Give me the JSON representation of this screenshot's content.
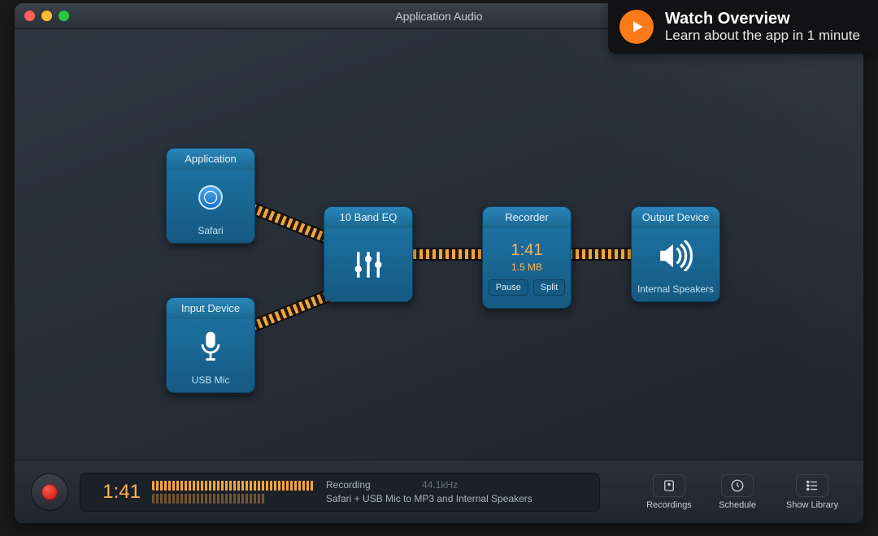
{
  "window": {
    "title": "Application Audio"
  },
  "overview": {
    "title": "Watch Overview",
    "subtitle": "Learn about the app in 1 minute"
  },
  "tiles": {
    "application": {
      "header": "Application",
      "label": "Safari"
    },
    "input": {
      "header": "Input Device",
      "label": "USB Mic"
    },
    "eq": {
      "header": "10 Band EQ"
    },
    "recorder": {
      "header": "Recorder",
      "time": "1:41",
      "size": "1.5 MB",
      "pause_label": "Pause",
      "split_label": "Split"
    },
    "output": {
      "header": "Output Device",
      "label": "Internal Speakers"
    }
  },
  "bottombar": {
    "time": "1:41",
    "status_line1": "Recording",
    "sample_rate": "44.1kHz",
    "status_line2": "Safari + USB Mic to MP3 and Internal Speakers",
    "buttons": {
      "recordings": "Recordings",
      "schedule": "Schedule",
      "library": "Show Library"
    }
  }
}
